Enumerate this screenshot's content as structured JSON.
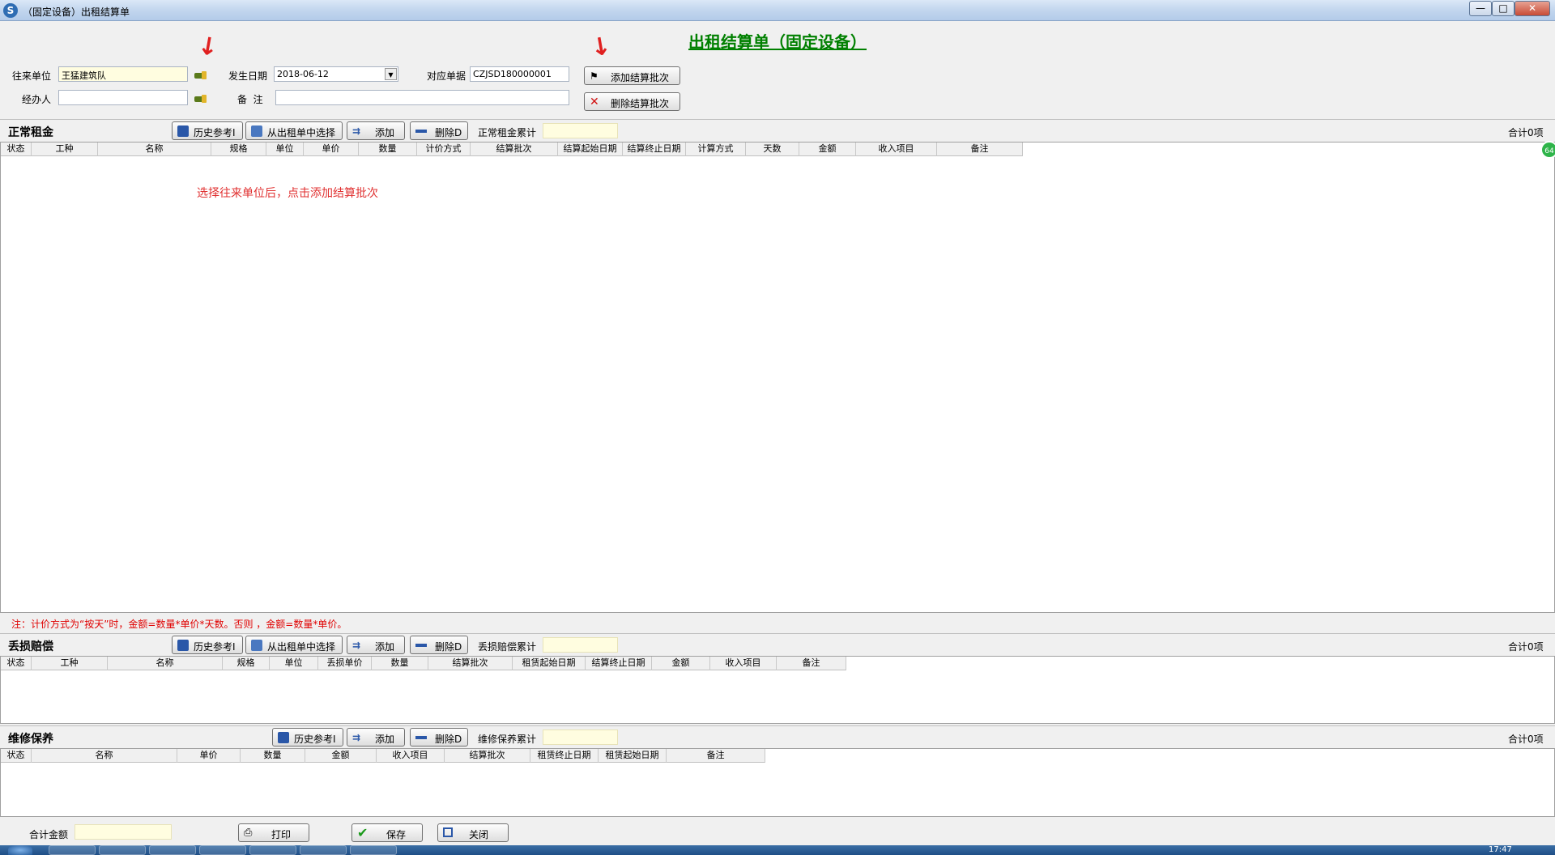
{
  "window": {
    "title": "（固定设备）出租结算单",
    "logo_text": "S",
    "controls": {
      "minimize": "—",
      "maximize": "□",
      "close": "✕"
    }
  },
  "header": {
    "heading": "出租结算单（固定设备）",
    "fields": {
      "partner_label": "往来单位",
      "partner_value": "王猛建筑队",
      "date_label": "发生日期",
      "date_value": "2018-06-12",
      "doc_label": "对应单据",
      "doc_value": "CZJSD180000001",
      "handler_label": "经办人",
      "handler_value": "",
      "remark_label": "备  注",
      "remark_value": ""
    },
    "buttons": {
      "add_batch": "添加结算批次",
      "delete_batch": "删除结算批次"
    }
  },
  "normal_rent": {
    "title": "正常租金",
    "buttons": {
      "history": "历史参考I",
      "from_order": "从出租单中选择",
      "add": "添加",
      "delete": "删除D"
    },
    "total_label": "正常租金累计",
    "total_value": "",
    "count": "合计0项",
    "columns": [
      "状态",
      "工种",
      "名称",
      "规格",
      "单位",
      "单价",
      "数量",
      "计价方式",
      "结算批次",
      "结算起始日期",
      "结算终止日期",
      "计算方式",
      "天数",
      "金额",
      "收入项目",
      "备注"
    ],
    "hint": "选择往来单位后，点击添加结算批次",
    "note": "注：计价方式为“按天”时，金额=数量*单价*天数。否则 ，金额=数量*单价。"
  },
  "loss_comp": {
    "title": "丢损赔偿",
    "buttons": {
      "history": "历史参考I",
      "from_order": "从出租单中选择",
      "add": "添加",
      "delete": "删除D"
    },
    "total_label": "丢损赔偿累计",
    "total_value": "",
    "count": "合计0项",
    "columns": [
      "状态",
      "工种",
      "名称",
      "规格",
      "单位",
      "丢损单价",
      "数量",
      "结算批次",
      "租赁起始日期",
      "结算终止日期",
      "金额",
      "收入项目",
      "备注"
    ]
  },
  "maintenance": {
    "title": "维修保养",
    "buttons": {
      "history": "历史参考I",
      "add": "添加",
      "delete": "删除D"
    },
    "total_label": "维修保养累计",
    "total_value": "",
    "count": "合计0项",
    "columns": [
      "状态",
      "名称",
      "单价",
      "数量",
      "金额",
      "收入项目",
      "结算批次",
      "租赁终止日期",
      "租赁起始日期",
      "备注"
    ]
  },
  "footer": {
    "total_label": "合计金额",
    "total_value": "",
    "print": "打印",
    "save": "保存",
    "close": "关闭"
  },
  "taskbar": {
    "clock": "17:47",
    "badge": "64"
  },
  "colors": {
    "heading_green": "#008000",
    "note_red": "#e00000",
    "input_yellow": "#fffde0"
  }
}
